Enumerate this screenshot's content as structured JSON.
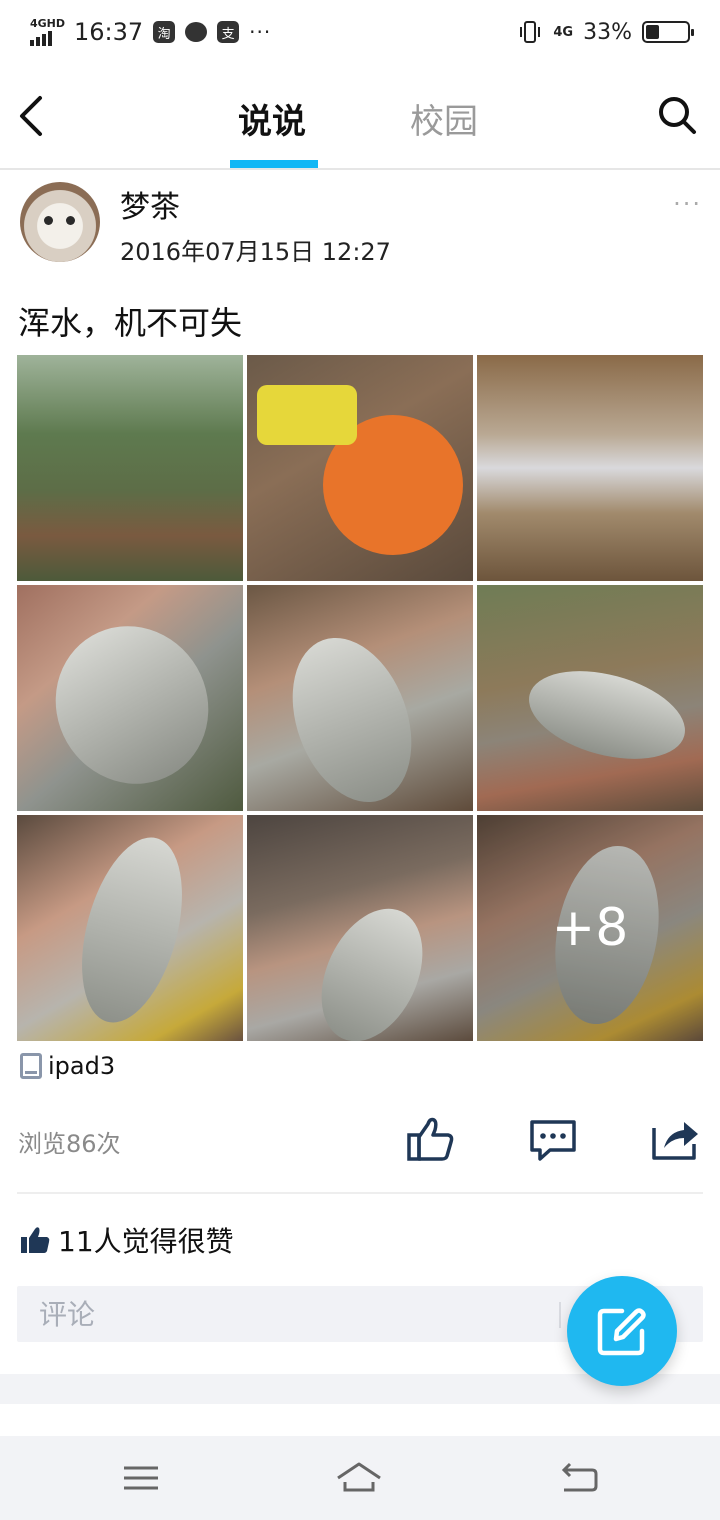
{
  "status_bar": {
    "network_label": "4GHD",
    "time": "16:37",
    "app_icons": [
      "淘",
      "支"
    ],
    "more": "···",
    "signal_label": "4G",
    "battery_percent": "33%",
    "battery_level": 0.33
  },
  "header": {
    "tabs": [
      {
        "label": "说说",
        "active": true
      },
      {
        "label": "校园",
        "active": false
      }
    ]
  },
  "post": {
    "username": "梦茶",
    "timestamp": "2016年07月15日 12:27",
    "more": "···",
    "text": "浑水，机不可失",
    "extra_photos": "+8",
    "device": "ipad3",
    "views": "浏览86次",
    "likes_text": "11人觉得很赞"
  },
  "comment": {
    "placeholder": "评论"
  },
  "colors": {
    "accent": "#12b7f5",
    "fab": "#1fb8f0",
    "icon_dark": "#1f3756"
  },
  "icons": [
    "back-arrow-icon",
    "search-icon",
    "tablet-icon",
    "thumbs-up-icon",
    "comment-icon",
    "share-icon",
    "edit-icon",
    "menu-icon",
    "home-icon",
    "return-icon"
  ]
}
